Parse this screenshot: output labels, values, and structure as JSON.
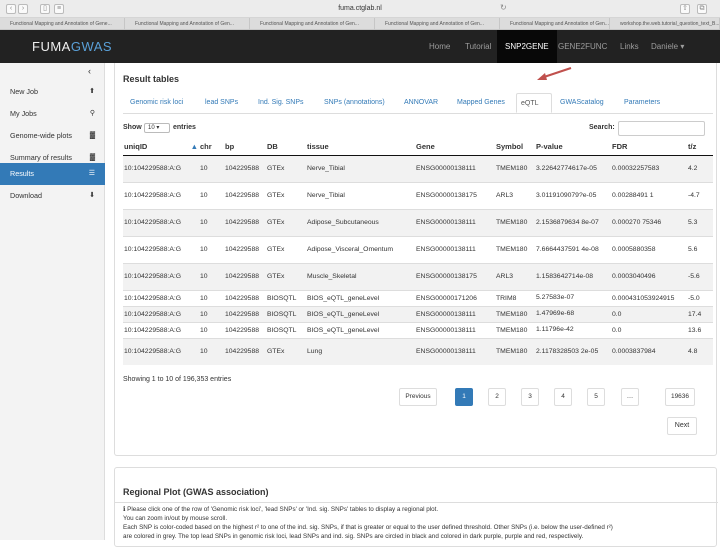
{
  "browser": {
    "url": "fuma.ctglab.nl",
    "tabs": [
      "Functional Mapping and Annotation of Gene...",
      "Functional Mapping and Annotation of Gen...",
      "Functional Mapping and Annotation of Gen...",
      "Functional Mapping and Annotation of Gen...",
      "Functional Mapping and Annotation of Gen...",
      "workshop.the.web.tutorial_question_text_B..."
    ]
  },
  "navbar": {
    "logo_main": "FUMA",
    "logo_accent": "GWAS",
    "items": [
      "Home",
      "Tutorial",
      "SNP2GENE",
      "GENE2FUNC",
      "Links",
      "Daniele ▾"
    ],
    "active": "SNP2GENE"
  },
  "sidebar": {
    "collapse_glyph": "‹",
    "items": [
      {
        "label": "New Job",
        "icon": "⬆"
      },
      {
        "label": "My Jobs",
        "icon": "⚲"
      },
      {
        "label": "Genome-wide plots",
        "icon": "▓"
      },
      {
        "label": "Summary of results",
        "icon": "▓"
      },
      {
        "label": "Results",
        "icon": "☰"
      },
      {
        "label": "Download",
        "icon": "⬇"
      }
    ]
  },
  "results": {
    "title": "Result tables",
    "tabs": [
      "Genomic risk loci",
      "lead SNPs",
      "Ind. Sig. SNPs",
      "SNPs (annotations)",
      "ANNOVAR",
      "Mapped Genes",
      "eQTL",
      "GWAScatalog",
      "Parameters"
    ],
    "active_tab": "eQTL",
    "show_label": "Show",
    "page_length": "10",
    "entries_label": "entries",
    "search_label": "Search:",
    "columns": [
      "uniqID",
      "chr",
      "bp",
      "DB",
      "tissue",
      "Gene",
      "Symbol",
      "P-value",
      "FDR",
      "t/z"
    ],
    "rows": [
      [
        "10:104229588:A:G",
        "10",
        "104229588",
        "GTEx",
        "Nerve_Tibial",
        "ENSG00000138111",
        "TMEM180",
        "3.22642774617e-05",
        "0.00032257583",
        "4.2"
      ],
      [
        "10:104229588:A:G",
        "10",
        "104229588",
        "GTEx",
        "Nerve_Tibial",
        "ENSG00000138175",
        "ARL3",
        "3.0119109079?e-05",
        "0.00288491 1",
        "-4.7"
      ],
      [
        "10:104229588:A:G",
        "10",
        "104229588",
        "GTEx",
        "Adipose_Subcutaneous",
        "ENSG00000138111",
        "TMEM180",
        "2.1536879634 8e-07",
        "0.000270 75346",
        "5.3"
      ],
      [
        "10:104229588:A:G",
        "10",
        "104229588",
        "GTEx",
        "Adipose_Visceral_Omentum",
        "ENSG00000138111",
        "TMEM180",
        "7.6664437591 4e-08",
        "0.0005880358",
        "5.6"
      ],
      [
        "10:104229588:A:G",
        "10",
        "104229588",
        "GTEx",
        "Muscle_Skeletal",
        "ENSG00000138175",
        "ARL3",
        "1.1583642714e-08",
        "0.0003040496",
        "-5.6"
      ],
      [
        "10:104229588:A:G",
        "10",
        "104229588",
        "BIOSQTL",
        "BIOS_eQTL_geneLevel",
        "ENSG00000171206",
        "TRIM8",
        "5.27583e-07",
        "0.000431053924915",
        "-5.0"
      ],
      [
        "10:104229588:A:G",
        "10",
        "104229588",
        "BIOSQTL",
        "BIOS_eQTL_geneLevel",
        "ENSG00000138111",
        "TMEM180",
        "1.47969e-68",
        "0.0",
        "17.4"
      ],
      [
        "10:104229588:A:G",
        "10",
        "104229588",
        "BIOSQTL",
        "BIOS_eQTL_geneLevel",
        "ENSG00000138111",
        "TMEM180",
        "1.11796e-42",
        "0.0",
        "13.6"
      ],
      [
        "10:104229588:A:G",
        "10",
        "104229588",
        "GTEx",
        "Lung",
        "ENSG00000138111",
        "TMEM180",
        "2.1178328503 2e-05",
        "0.0003837984",
        "4.8"
      ]
    ],
    "info": "Showing 1 to 10 of 196,353 entries",
    "pagination": [
      "Previous",
      "1",
      "2",
      "3",
      "4",
      "5",
      "…",
      "19636"
    ],
    "active_page": "1",
    "next_label": "Next"
  },
  "regional_plot": {
    "title": "Regional Plot (GWAS association)",
    "lines": [
      "ℹ Please click one of the row of 'Genomic risk loci', 'lead SNPs' or 'Ind. sig. SNPs' tables to display a regional plot.",
      "You can zoom in/out by mouse scroll.",
      "Each SNP is color-coded based on the highest r² to one of the ind. sig. SNPs, if that is greater or equal to the user defined threshold. Other SNPs (i.e. below the user-defined r²)",
      "are colored in grey. The top lead SNPs in genomic risk loci, lead SNPs and ind. sig. SNPs are circled in black and colored in dark purple, purple and red, respectively."
    ]
  },
  "colors": {
    "navbar": "#222222",
    "active_blue": "#337ab7",
    "arrow": "#c0504d"
  }
}
